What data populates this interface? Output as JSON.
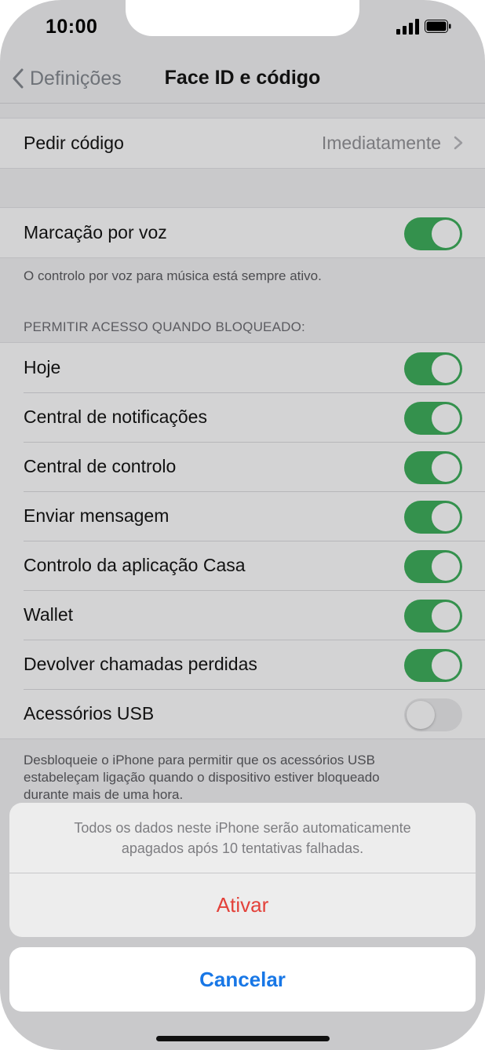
{
  "status_bar": {
    "time": "10:00"
  },
  "nav": {
    "back_label": "Definições",
    "title": "Face ID e código"
  },
  "require_code": {
    "label": "Pedir código",
    "value": "Imediatamente"
  },
  "voice_dial": {
    "label": "Marcação por voz",
    "on": true,
    "footer": "O controlo por voz para música está sempre ativo."
  },
  "locked_access": {
    "header": "PERMITIR ACESSO QUANDO BLOQUEADO:",
    "items": [
      {
        "label": "Hoje",
        "on": true
      },
      {
        "label": "Central de notificações",
        "on": true
      },
      {
        "label": "Central de controlo",
        "on": true
      },
      {
        "label": "Enviar mensagem",
        "on": true
      },
      {
        "label": "Controlo da aplicação Casa",
        "on": true
      },
      {
        "label": "Wallet",
        "on": true
      },
      {
        "label": "Devolver chamadas perdidas",
        "on": true
      },
      {
        "label": "Acessórios USB",
        "on": false
      }
    ],
    "footer_lines": [
      "Desbloqueie o iPhone para permitir que os acessórios USB",
      "estabeleçam ligação quando o dispositivo estiver bloqueado",
      "durante mais de uma hora."
    ]
  },
  "action_sheet": {
    "message_lines": [
      "Todos os dados neste iPhone serão automaticamente",
      "apagados após 10 tentativas falhadas."
    ],
    "confirm_label": "Ativar",
    "cancel_label": "Cancelar"
  },
  "colors": {
    "toggle_on": "#34914d",
    "destructive": "#e3413a",
    "link": "#1877e6"
  }
}
